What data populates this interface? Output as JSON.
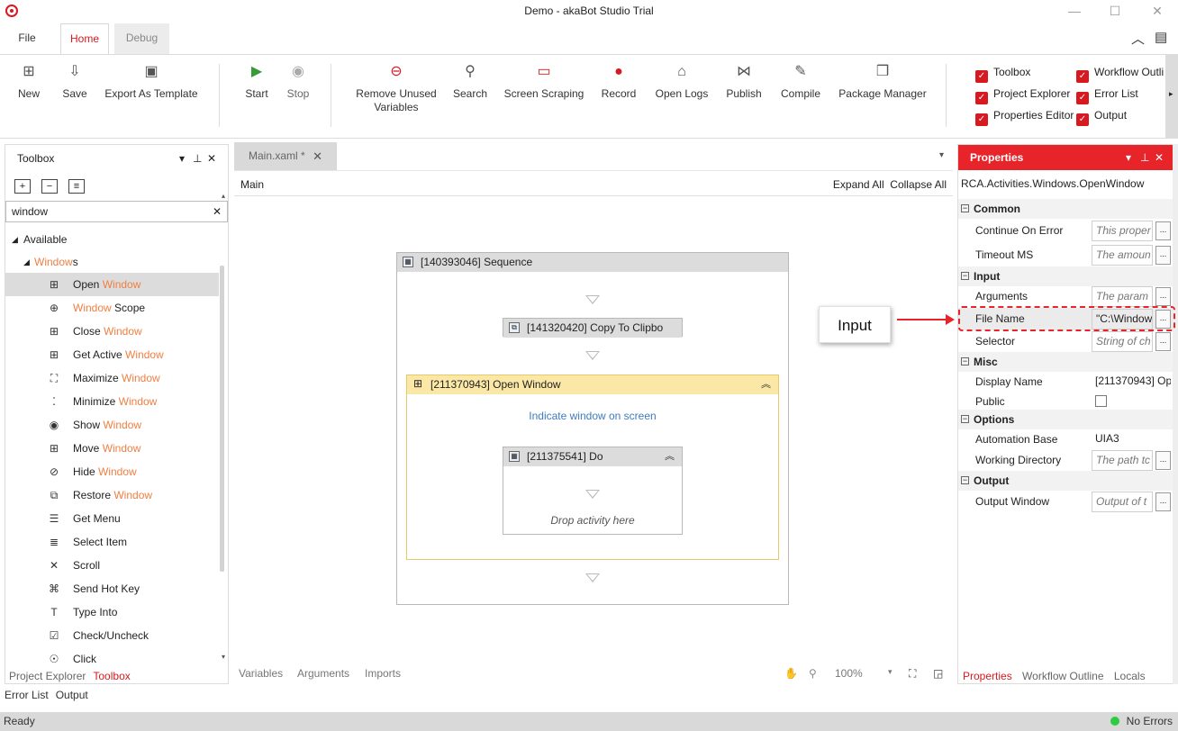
{
  "window": {
    "title": "Demo - akaBot Studio Trial"
  },
  "ribbon_tabs": {
    "file": "File",
    "home": "Home",
    "debug": "Debug"
  },
  "ribbon": {
    "new": "New",
    "save": "Save",
    "export": "Export As Template",
    "start": "Start",
    "stop": "Stop",
    "remove_unused": "Remove Unused",
    "remove_unused_2": "Variables",
    "search": "Search",
    "screen_scraping": "Screen Scraping",
    "record": "Record",
    "open_logs": "Open Logs",
    "publish": "Publish",
    "compile": "Compile",
    "package_manager": "Package Manager",
    "checks": {
      "toolbox": "Toolbox",
      "workflow_outline": "Workflow Outli",
      "project_explorer": "Project Explorer",
      "error_list": "Error List",
      "properties_editor": "Properties Editor",
      "output": "Output"
    }
  },
  "toolbox": {
    "title": "Toolbox",
    "search_value": "window",
    "available": "Available",
    "group_hl": "Window",
    "group_rest": "s",
    "items": [
      {
        "pre": "Open ",
        "hl": "Window",
        "post": "",
        "icon": "windows-icon"
      },
      {
        "pre": "",
        "hl": "Window",
        "post": " Scope",
        "icon": "crosshair-icon"
      },
      {
        "pre": "Close ",
        "hl": "Window",
        "post": "",
        "icon": "windows-icon"
      },
      {
        "pre": "Get Active ",
        "hl": "Window",
        "post": "",
        "icon": "windows-icon"
      },
      {
        "pre": "Maximize ",
        "hl": "Window",
        "post": "",
        "icon": "maximize-icon"
      },
      {
        "pre": "Minimize ",
        "hl": "Window",
        "post": "",
        "icon": "minimize-icon"
      },
      {
        "pre": "Show ",
        "hl": "Window",
        "post": "",
        "icon": "eye-icon"
      },
      {
        "pre": "Move ",
        "hl": "Window",
        "post": "",
        "icon": "windows-icon"
      },
      {
        "pre": "Hide ",
        "hl": "Window",
        "post": "",
        "icon": "eye-off-icon"
      },
      {
        "pre": "Restore ",
        "hl": "Window",
        "post": "",
        "icon": "restore-icon"
      },
      {
        "pre": "Get Menu",
        "hl": "",
        "post": "",
        "icon": "menu-icon"
      },
      {
        "pre": "Select Item",
        "hl": "",
        "post": "",
        "icon": "list-icon"
      },
      {
        "pre": "Scroll",
        "hl": "",
        "post": "",
        "icon": "scroll-icon"
      },
      {
        "pre": "Send Hot Key",
        "hl": "",
        "post": "",
        "icon": "command-key-icon"
      },
      {
        "pre": "Type Into",
        "hl": "",
        "post": "",
        "icon": "text-icon"
      },
      {
        "pre": "Check/Uncheck",
        "hl": "",
        "post": "",
        "icon": "checkbox-icon"
      },
      {
        "pre": "Click",
        "hl": "",
        "post": "",
        "icon": "click-icon"
      }
    ],
    "bottom_tabs": {
      "project_explorer": "Project Explorer",
      "toolbox": "Toolbox"
    }
  },
  "bottom_bar": {
    "error_list": "Error List",
    "output": "Output"
  },
  "designer": {
    "doc_tab": "Main.xaml *",
    "breadcrumb": "Main",
    "expand_all": "Expand All",
    "collapse_all": "Collapse All",
    "sequence": "[140393046] Sequence",
    "copy_clipboard": "[141320420] Copy To Clipbo",
    "open_window": "[211370943] Open Window",
    "indicate": "Indicate window on screen",
    "do": "[211375541] Do",
    "drop": "Drop activity here",
    "foot": {
      "variables": "Variables",
      "arguments": "Arguments",
      "imports": "Imports",
      "zoom": "100%"
    }
  },
  "properties": {
    "title": "Properties",
    "type": "RCA.Activities.Windows.OpenWindow",
    "cats": {
      "common": "Common",
      "input": "Input",
      "misc": "Misc",
      "options": "Options",
      "output": "Output"
    },
    "continue_on_error": {
      "name": "Continue On Error",
      "placeholder": "This proper"
    },
    "timeout": {
      "name": "Timeout MS",
      "placeholder": "The amoun"
    },
    "arguments": {
      "name": "Arguments",
      "placeholder": "The param"
    },
    "file_name": {
      "name": "File Name",
      "value": "\"C:\\Window"
    },
    "selector": {
      "name": "Selector",
      "placeholder": "String of ch"
    },
    "display_name": {
      "name": "Display Name",
      "value": "[211370943] Op"
    },
    "public": {
      "name": "Public"
    },
    "automation_base": {
      "name": "Automation Base",
      "value": "UIA3"
    },
    "working_dir": {
      "name": "Working Directory",
      "placeholder": "The path tc"
    },
    "output_window": {
      "name": "Output Window",
      "placeholder": "Output of t"
    },
    "bottom_tabs": {
      "properties": "Properties",
      "workflow_outline": "Workflow Outline",
      "locals": "Locals"
    }
  },
  "annotation": {
    "label": "Input"
  },
  "status": {
    "ready": "Ready",
    "errors": "No Errors"
  },
  "colors": {
    "accent": "#d71920",
    "highlight": "#ef7f41",
    "props_header": "#e8242b"
  }
}
